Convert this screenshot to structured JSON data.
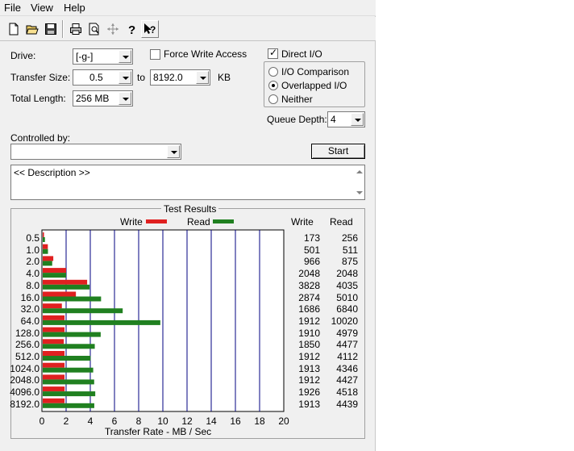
{
  "menu": {
    "file": "File",
    "view": "View",
    "help": "Help"
  },
  "toolbar": [
    "new-icon",
    "open-icon",
    "save-icon",
    "print-icon",
    "print-preview-icon",
    "move-icon",
    "help-icon",
    "context-help-icon"
  ],
  "form": {
    "drive_label": "Drive:",
    "drive_value": "[-g-]",
    "force_write_label": "Force Write Access",
    "force_write_checked": false,
    "direct_io_label": "Direct I/O",
    "direct_io_checked": true,
    "transfer_size_label": "Transfer Size:",
    "transfer_from": "0.5",
    "to_label": "to",
    "transfer_to": "8192.0",
    "kb_label": "KB",
    "total_length_label": "Total Length:",
    "total_length_value": "256 MB",
    "io_options": [
      {
        "label": "I/O Comparison",
        "checked": false
      },
      {
        "label": "Overlapped I/O",
        "checked": true
      },
      {
        "label": "Neither",
        "checked": false
      }
    ],
    "queue_depth_label": "Queue Depth:",
    "queue_depth_value": "4",
    "controlled_by_label": "Controlled by:",
    "controlled_by_value": "",
    "start_label": "Start",
    "description": "<< Description >>"
  },
  "results": {
    "title": "Test Results",
    "write_label": "Write",
    "read_label": "Read",
    "col_write": "Write",
    "col_read": "Read",
    "write_color": "#e02020",
    "read_color": "#208020"
  },
  "chart_data": {
    "type": "bar",
    "orientation": "horizontal",
    "xlabel": "Transfer Rate - MB / Sec",
    "xlim": [
      0,
      20
    ],
    "xticks": [
      "0",
      "2",
      "4",
      "6",
      "8",
      "10",
      "12",
      "14",
      "16",
      "18",
      "20"
    ],
    "categories": [
      "0.5",
      "1.0",
      "2.0",
      "4.0",
      "8.0",
      "16.0",
      "32.0",
      "64.0",
      "128.0",
      "256.0",
      "512.0",
      "1024.0",
      "2048.0",
      "4096.0",
      "8192.0"
    ],
    "series": [
      {
        "name": "Write",
        "values_text": [
          "173",
          "501",
          "966",
          "2048",
          "3828",
          "2874",
          "1686",
          "1912",
          "1910",
          "1850",
          "1912",
          "1913",
          "1912",
          "1926",
          "1913"
        ],
        "values": [
          0.17,
          0.49,
          0.94,
          2.0,
          3.74,
          2.81,
          1.65,
          1.87,
          1.87,
          1.81,
          1.87,
          1.87,
          1.87,
          1.88,
          1.87
        ]
      },
      {
        "name": "Read",
        "values_text": [
          "256",
          "511",
          "875",
          "2048",
          "4035",
          "5010",
          "6840",
          "10020",
          "4979",
          "4477",
          "4112",
          "4346",
          "4427",
          "4518",
          "4439"
        ],
        "values": [
          0.25,
          0.5,
          0.85,
          2.0,
          3.94,
          4.89,
          6.68,
          9.79,
          4.86,
          4.37,
          4.02,
          4.24,
          4.32,
          4.41,
          4.33
        ]
      }
    ],
    "grid": true,
    "legend": "top"
  }
}
